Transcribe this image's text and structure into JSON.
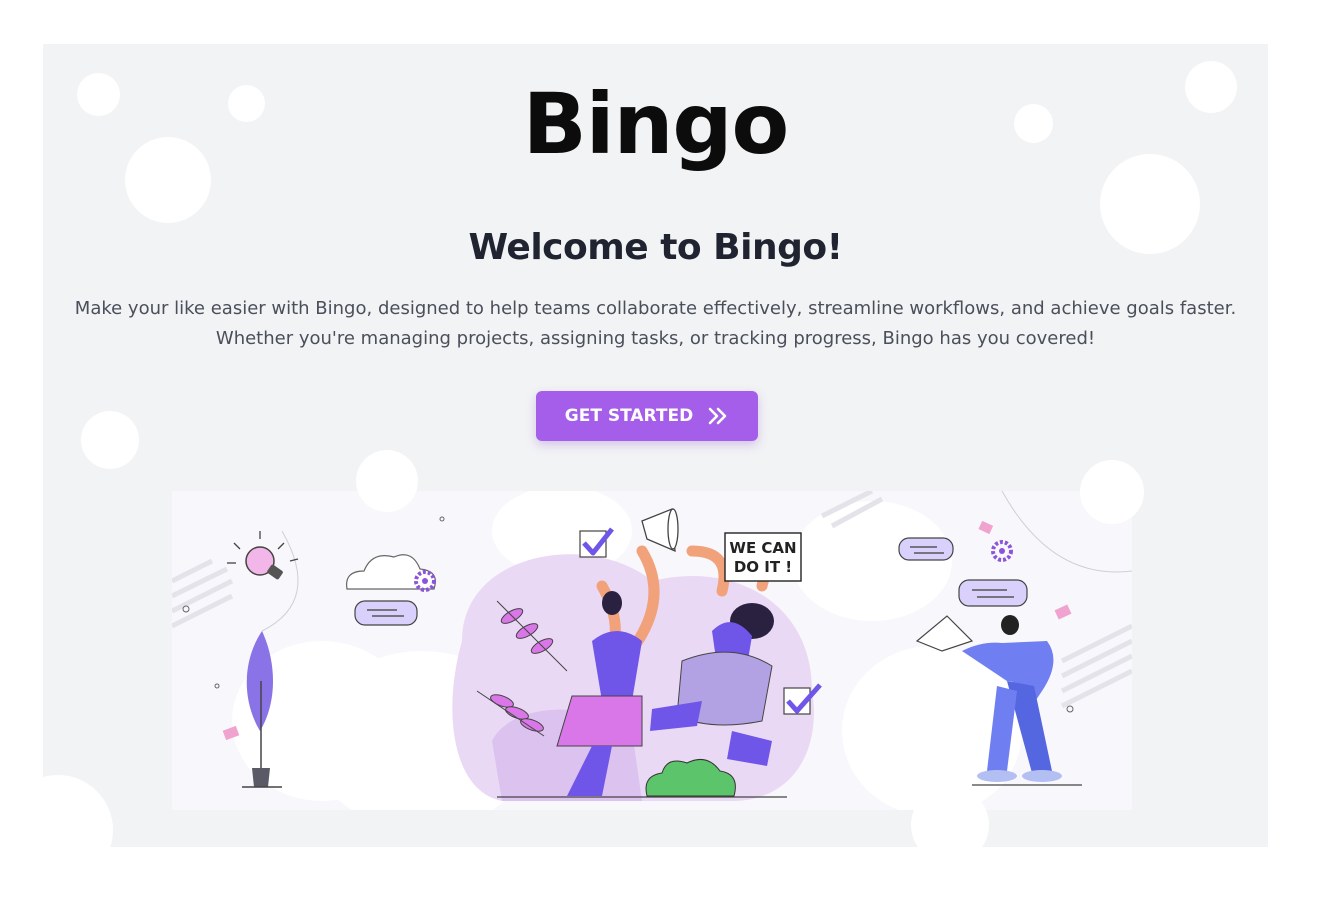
{
  "brand": {
    "logo_text": "Bingo"
  },
  "hero": {
    "headline": "Welcome to Bingo!",
    "description_line1": "Make your like easier with Bingo, designed to help teams collaborate effectively, streamline workflows, and achieve goals faster.",
    "description_line2": "Whether you're managing projects, assigning tasks, or tracking progress, Bingo has you covered!",
    "cta_label": "GET STARTED",
    "cta_icon": "double-chevron-right-icon"
  },
  "illustration": {
    "sign_line1": "WE CAN",
    "sign_line2": "DO IT !"
  },
  "colors": {
    "accent": "#a55eea",
    "hero_bg": "#f2f3f5",
    "illustration_purple": "#7b5cf0",
    "illustration_pink": "#d977e8"
  }
}
